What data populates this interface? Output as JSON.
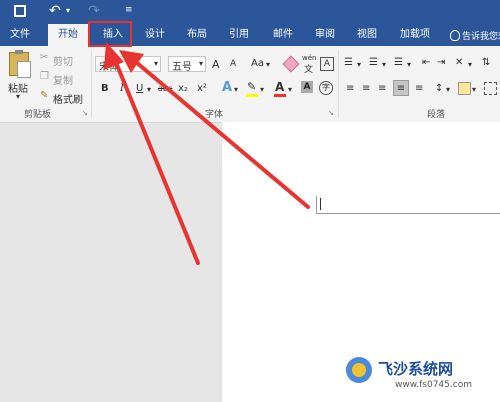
{
  "quick_access": {
    "undo": "↶",
    "redo": "↷",
    "more": "≡"
  },
  "tabs": [
    {
      "label": "文件"
    },
    {
      "label": "开始"
    },
    {
      "label": "插入"
    },
    {
      "label": "设计"
    },
    {
      "label": "布局"
    },
    {
      "label": "引用"
    },
    {
      "label": "邮件"
    },
    {
      "label": "审阅"
    },
    {
      "label": "视图"
    },
    {
      "label": "加载项"
    }
  ],
  "tell_me": "告诉我您想",
  "clipboard": {
    "paste": "粘贴",
    "cut": "剪切",
    "copy": "复制",
    "format_painter": "格式刷",
    "group": "剪贴板"
  },
  "font": {
    "name": "宋体",
    "size": "五号",
    "grow": "A",
    "shrink": "A",
    "case": "Aa",
    "phonetic": "wén",
    "bold": "B",
    "italic": "I",
    "underline": "U",
    "strike": "abc",
    "sub": "x₂",
    "sup": "x²",
    "group": "字体"
  },
  "paragraph": {
    "group": "段落"
  },
  "watermark": {
    "site": "飞沙系统网",
    "url": "www.fs0745.com"
  },
  "colors": {
    "accent": "#2b579a",
    "annotation": "#e8332f"
  }
}
